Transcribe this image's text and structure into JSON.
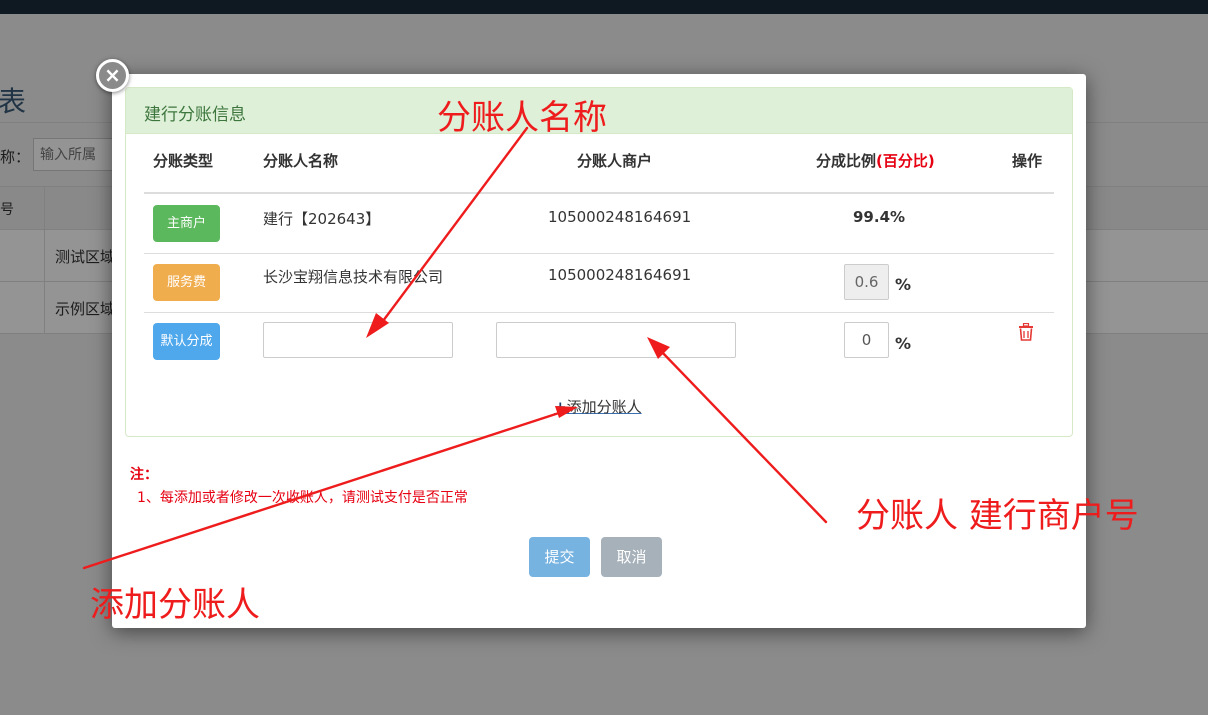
{
  "background": {
    "title_fragment": "表",
    "search_label": "称：",
    "search_placeholder": "输入所属",
    "header_first": "号",
    "rows": [
      "测试区域",
      "示例区域"
    ]
  },
  "modal": {
    "close_glyph": "×",
    "panel_title": "建行分账信息",
    "headers": {
      "type": "分账类型",
      "name": "分账人名称",
      "merchant": "分账人商户",
      "ratio": "分成比例",
      "ratio_note": "(百分比)",
      "action": "操作"
    },
    "rows": [
      {
        "badge": "主商户",
        "badge_color": "#5cb85c",
        "name": "建行【202643】",
        "merchant": "105000248164691",
        "ratio": "99.4%"
      },
      {
        "badge": "服务费",
        "badge_color": "#f0ad4e",
        "name": "长沙宝翔信息技术有限公司",
        "merchant": "105000248164691",
        "ratio": "0.6",
        "unit": "%"
      },
      {
        "badge": "默认分成",
        "badge_color": "#4fa7ec",
        "name": "",
        "merchant": "",
        "ratio": "0",
        "unit": "%",
        "delete_icon": "trash-icon"
      }
    ],
    "add_link": "添加分账人",
    "note_title": "注：",
    "note_text": "1、每添加或者修改一次收账人，请测试支付是否正常",
    "submit": "提交",
    "cancel": "取消"
  },
  "annotations": {
    "name": "分账人名称",
    "merchant": "分账人 建行商户号",
    "add": "添加分账人",
    "color": "#ee1c1c"
  }
}
